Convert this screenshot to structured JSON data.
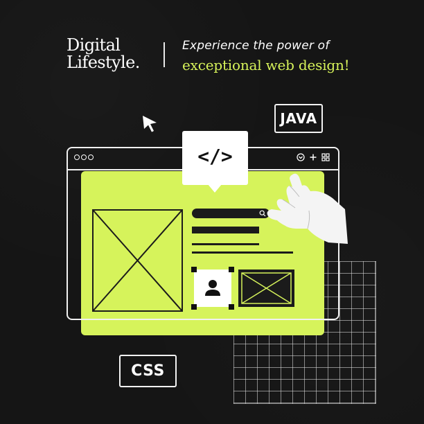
{
  "brand": {
    "line1": "Digital",
    "line2": "Lifestyle."
  },
  "tagline": {
    "line1": "Experience the power of",
    "line2": "exceptional web design!"
  },
  "badges": {
    "code": "</>",
    "java": "JAVA",
    "css": "CSS"
  },
  "icons": {
    "cursor": "pointer-cursor-icon",
    "search": "search-icon",
    "chevron": "chevron-circle-icon",
    "plus": "plus-icon",
    "grid": "grid-icon",
    "avatar": "user-icon",
    "hand": "hand-icon"
  },
  "colors": {
    "background": "#151515",
    "accent": "#d6f35b",
    "foreground": "#ffffff",
    "ink": "#1b1b1b"
  }
}
